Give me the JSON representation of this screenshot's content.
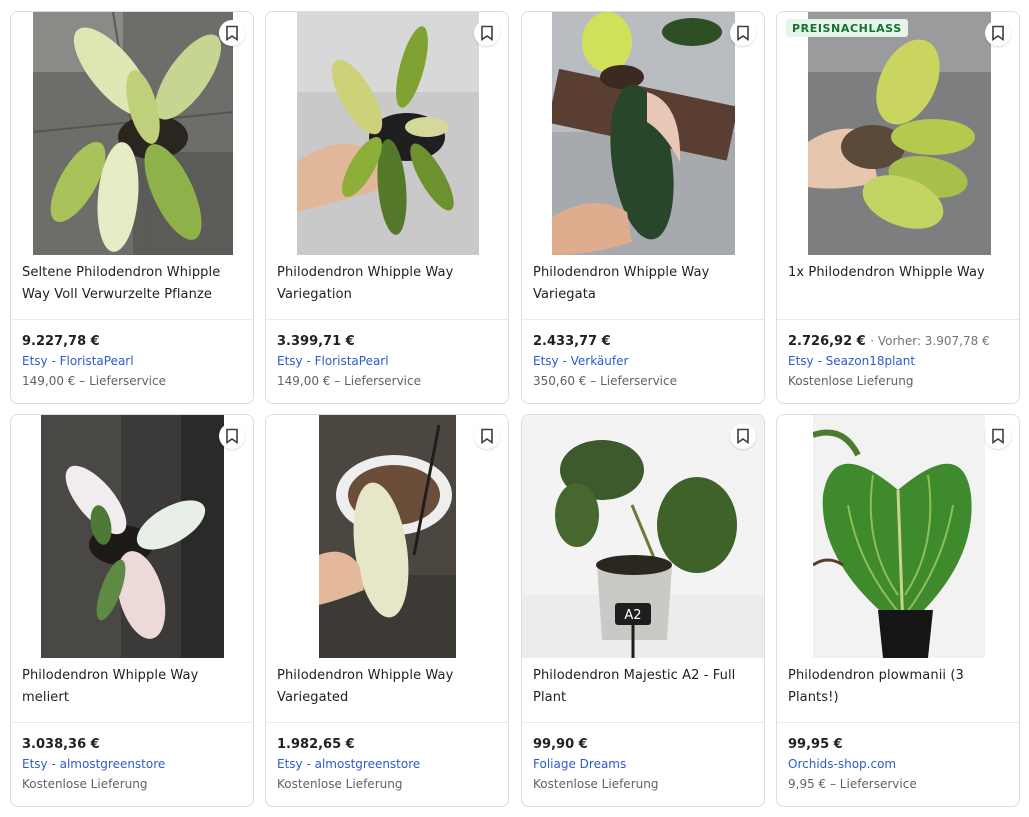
{
  "badge_label": "PREISNACHLASS",
  "colors": {
    "seller_link": "#2b5ccc",
    "badge_bg": "#e6f4ea",
    "badge_text": "#137333",
    "border": "#dadce0"
  },
  "products": [
    {
      "title": "Seltene Philodendron Whipple Way Voll Verwurzelte Pflanze",
      "price": "9.227,78 €",
      "seller": "Etsy - FloristaPearl",
      "shipping": "149,00 € – Lieferservice",
      "bookmark_icon": "bookmark-outline-icon",
      "image": "variegated-philodendron-pot-on-stone-floor"
    },
    {
      "title": "Philodendron Whipple Way Variegation",
      "price": "3.399,71 €",
      "seller": "Etsy - FloristaPearl",
      "shipping": "149,00 € – Lieferservice",
      "bookmark_icon": "bookmark-outline-icon",
      "image": "hand-holding-philodendron-pot"
    },
    {
      "title": "Philodendron Whipple Way Variegata",
      "price": "2.433,77 €",
      "seller": "Etsy - Verkäufer",
      "shipping": "350,60 € – Lieferservice",
      "bookmark_icon": "bookmark-outline-icon",
      "image": "hand-holding-variegated-leaf"
    },
    {
      "title": "1x Philodendron Whipple Way",
      "price": "2.726,92 €",
      "previous_price": "· Vorher: 3.907,78 €",
      "seller": "Etsy - Seazon18plant",
      "shipping": "Kostenlose Lieferung",
      "discount": true,
      "bookmark_icon": "bookmark-outline-icon",
      "image": "hand-holding-yellow-green-philodendron"
    },
    {
      "title": "Philodendron Whipple Way meliert",
      "price": "3.038,36 €",
      "seller": "Etsy - almostgreenstore",
      "shipping": "Kostenlose Lieferung",
      "bookmark_icon": "bookmark-outline-icon",
      "image": "white-variegated-philodendron-dark-background"
    },
    {
      "title": "Philodendron Whipple Way Variegated",
      "price": "1.982,65 €",
      "seller": "Etsy - almostgreenstore",
      "shipping": "Kostenlose Lieferung",
      "bookmark_icon": "bookmark-outline-icon",
      "image": "hand-holding-pale-leaf-over-pot"
    },
    {
      "title": "Philodendron Majestic A2 - Full Plant",
      "price": "99,90 €",
      "seller": "Foliage Dreams",
      "shipping": "Kostenlose Lieferung",
      "bookmark_icon": "bookmark-outline-icon",
      "image": "philodendron-majestic-concrete-pot",
      "pot_label": "A2"
    },
    {
      "title": "Philodendron plowmanii (3 Plants!)",
      "price": "99,95 €",
      "seller": "Orchids-shop.com",
      "shipping": "9,95 € – Lieferservice",
      "bookmark_icon": "bookmark-outline-icon",
      "image": "philodendron-plowmanii-heart-leaf-black-pot"
    }
  ]
}
